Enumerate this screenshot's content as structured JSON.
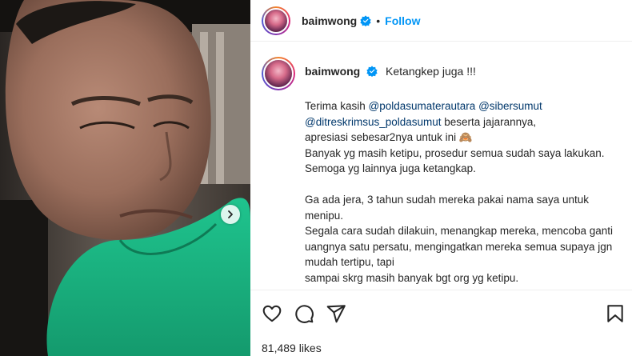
{
  "post": {
    "username": "baimwong",
    "follow_label": "Follow",
    "separator": "•"
  },
  "caption": {
    "username": "baimwong",
    "first_line": "Ketangkep juga !!!",
    "line1_prefix": "Terima kasih ",
    "mention1": "@poldasumaterautara",
    "mention2": "@sibersumut",
    "mention3": "@ditreskrimsus_poldasumut",
    "line2_suffix": " beserta jajarannya,",
    "line3": "apresiasi sebesar2nya untuk ini 🙈",
    "line4": "Banyak yg masih ketipu, prosedur semua sudah saya lakukan.",
    "line5": "Semoga yg lainnya juga ketangkap.",
    "line6": "Ga ada jera, 3 tahun sudah mereka pakai nama saya untuk",
    "line7": "menipu.",
    "line8": "Segala cara sudah dilakuin, menangkap mereka, mencoba ganti",
    "line9": "uangnya satu persatu, mengingatkan mereka semua supaya jgn",
    "line10": "mudah tertipu, tapi",
    "line11": "sampai skrg masih banyak bgt org yg ketipu."
  },
  "likes": {
    "count_text": "81,489 likes"
  },
  "icons": {
    "verified": "verified-badge-icon",
    "like": "heart-icon",
    "comment": "comment-icon",
    "share": "share-icon",
    "save": "bookmark-icon",
    "carousel": "chevron-right-icon"
  },
  "colors": {
    "link": "#0095f6",
    "mention": "#00376b",
    "verified": "#0095f6"
  }
}
